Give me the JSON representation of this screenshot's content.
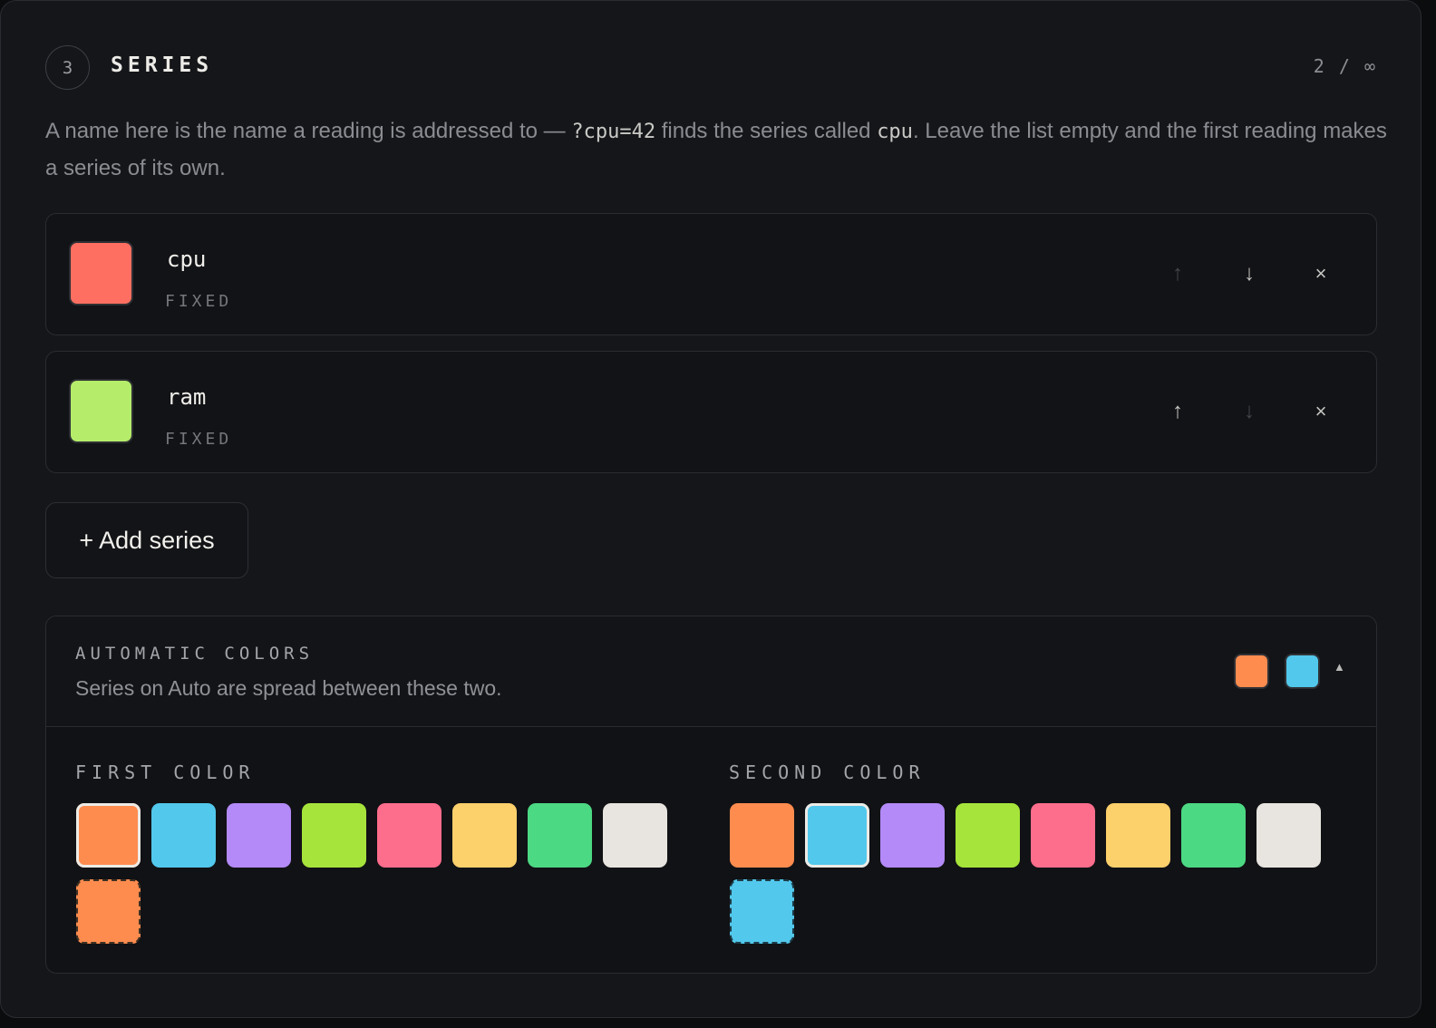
{
  "header": {
    "step": "3",
    "title": "SERIES",
    "counter": "2 / ∞"
  },
  "description": {
    "part1": "A name here is the name a reading is addressed to — ",
    "code1": "?cpu=42",
    "part2": " finds the series called ",
    "code2": "cpu",
    "part3": ". Leave the list empty and the first reading makes a series of its own."
  },
  "series": [
    {
      "name": "cpu",
      "mode": "FIXED",
      "color": "#ff6f61",
      "up_enabled": false,
      "down_enabled": true
    },
    {
      "name": "ram",
      "mode": "FIXED",
      "color": "#b5ec6a",
      "up_enabled": true,
      "down_enabled": false
    }
  ],
  "row_icons": {
    "up": "↑",
    "down": "↓",
    "remove": "×"
  },
  "add_button": {
    "label": "+ Add series"
  },
  "auto_colors": {
    "title": "AUTOMATIC COLORS",
    "subtitle": "Series on Auto are spread between these two.",
    "first_color": "#ff8c4f",
    "second_color": "#52c8ec",
    "toggle_icon": "▲",
    "first_label": "FIRST COLOR",
    "second_label": "SECOND COLOR",
    "palette": [
      "#ff8c4f",
      "#52c8ec",
      "#b38af8",
      "#a6e43b",
      "#fd6d8c",
      "#fcd06b",
      "#4cd983",
      "#e8e4df"
    ],
    "first_selected_index": 0,
    "second_selected_index": 1
  }
}
